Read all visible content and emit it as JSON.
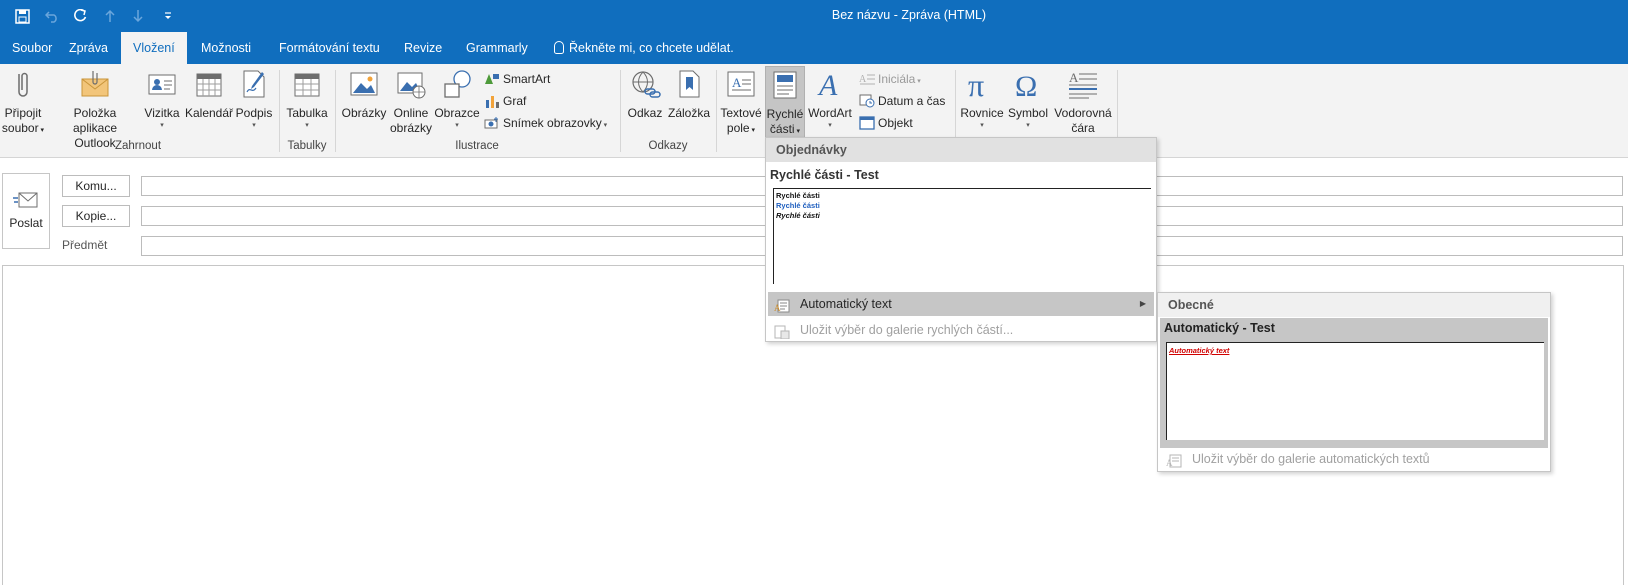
{
  "window": {
    "title": "Bez názvu  -  Zpráva (HTML)"
  },
  "quick_access": {
    "save_icon": "save-icon",
    "undo_icon": "undo-icon",
    "redo_icon": "redo-icon",
    "up_icon": "arrow-up-icon",
    "down_icon": "arrow-down-icon",
    "customize_icon": "customize-icon"
  },
  "tabs": [
    {
      "label": "Soubor"
    },
    {
      "label": "Zpráva"
    },
    {
      "label": "Vložení"
    },
    {
      "label": "Možnosti"
    },
    {
      "label": "Formátování textu"
    },
    {
      "label": "Revize"
    },
    {
      "label": "Grammarly"
    },
    {
      "label": "Řekněte mi, co chcete udělat."
    }
  ],
  "ribbon": {
    "attach_file": {
      "line1": "Připojit",
      "line2": "soubor"
    },
    "outlook_item": {
      "line1": "Položka aplikace",
      "line2": "Outlook"
    },
    "business_card": {
      "line1": "Vizitka"
    },
    "calendar": {
      "line1": "Kalendář"
    },
    "signature": {
      "line1": "Podpis"
    },
    "table": {
      "line1": "Tabulka"
    },
    "pictures": {
      "line1": "Obrázky"
    },
    "online_pictures": {
      "line1": "Online",
      "line2": "obrázky"
    },
    "shapes": {
      "line1": "Obrazce"
    },
    "smartart": "SmartArt",
    "chart": "Graf",
    "screenshot": "Snímek obrazovky",
    "link": {
      "line1": "Odkaz"
    },
    "bookmark": {
      "line1": "Záložka"
    },
    "text_box": {
      "line1": "Textové",
      "line2": "pole"
    },
    "quick_parts": {
      "line1": "Rychlé",
      "line2": "části"
    },
    "wordart": {
      "line1": "WordArt"
    },
    "drop_cap": "Iniciála",
    "date_time": "Datum a čas",
    "object": "Objekt",
    "equation": {
      "line1": "Rovnice"
    },
    "symbol": {
      "line1": "Symbol"
    },
    "horizontal_line": {
      "line1": "Vodorovná",
      "line2": "čára"
    },
    "groups": {
      "include": "Zahrnout",
      "tables": "Tabulky",
      "illustrations": "Ilustrace",
      "links": "Odkazy"
    }
  },
  "message": {
    "send": "Poslat",
    "to": "Komu...",
    "cc": "Kopie...",
    "subject": "Předmět"
  },
  "quick_parts_menu": {
    "category": "Objednávky",
    "item_title": "Rychlé části - Test",
    "preview_lines": [
      "Rychlé části",
      "Rychlé části",
      "Rychlé části"
    ],
    "autotext": "Automatický text",
    "save_selection": "Uložit výběr do galerie rychlých částí..."
  },
  "autotext_menu": {
    "category": "Obecné",
    "item_title": "Automatický - Test",
    "preview_line": "Automatický text",
    "save_selection": "Uložit výběr do galerie automatických textů"
  },
  "colors": {
    "brand": "#106ebe",
    "preview_blue": "#1f5fbf",
    "preview_red": "#d00000"
  }
}
